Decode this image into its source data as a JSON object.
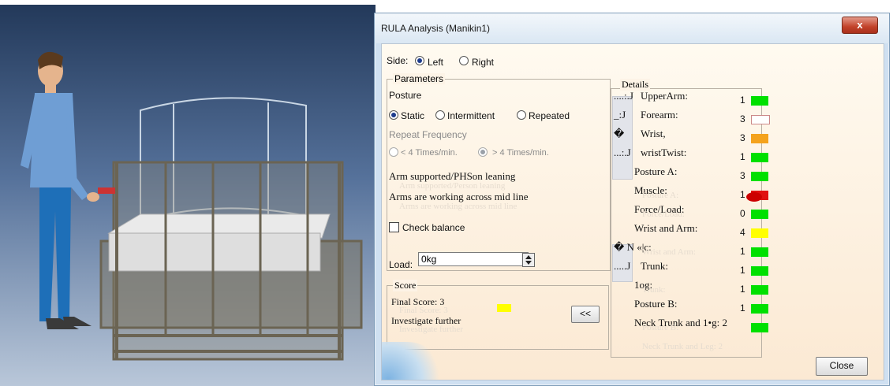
{
  "dialog": {
    "title": "RULA Analysis (Manikin1)",
    "close_glyph": "x",
    "side": {
      "label": "Side:",
      "left": "Left",
      "right": "Right",
      "selected": "Left"
    },
    "parameters": {
      "legend": "Parameters",
      "posture_label": "Posture",
      "posture_options": [
        "Static",
        "Intermittent",
        "Repeated"
      ],
      "posture_selected": "Static",
      "repeat_label": "Repeat Frequency",
      "repeat_options": [
        "< 4 Times/min.",
        "> 4 Times/min."
      ],
      "arm_supported": "Arm supported/PHSon leaning",
      "arm_supported_ghost": "Arm supported/Person leaning",
      "arms_midline": "Arms are working across mid line",
      "arms_midline_ghost": "Arms are working across mid line",
      "check_balance": "Check balance",
      "load_label": "Load:",
      "load_value": "0kg"
    },
    "score": {
      "legend": "Score",
      "final_score": "Final Score: 3",
      "final_score_ghost": "Final Score: 3",
      "recommendation": "Investigate further",
      "recommendation_ghost": "Investigate further",
      "collapse_button": "<<",
      "indicator_color": "#ffff00"
    },
    "details": {
      "legend": "Details",
      "rows": [
        {
          "prefix": "....:.J",
          "label": "UpperArm:",
          "score": "1",
          "color": "#00e000"
        },
        {
          "prefix": "_:J",
          "label": "Forearm:",
          "score": "3",
          "color": "#ffffff"
        },
        {
          "prefix": "�",
          "label": "Wrist,",
          "score": "3",
          "color": "#f4a21c"
        },
        {
          "prefix": "...:.J",
          "label": "wristTwist:",
          "score": "1",
          "color": "#00e000"
        },
        {
          "prefix": "",
          "label": "Posture A:",
          "score": "3",
          "color": "#00e000"
        },
        {
          "prefix": "",
          "label": "Muscle:",
          "score": "1",
          "color": "#e01010"
        },
        {
          "prefix": "",
          "label": "Force/Load:",
          "score": "0",
          "color": "#00e000"
        },
        {
          "prefix": "",
          "label": "Wrist and Arm:",
          "score": "4",
          "color": "#ffff00"
        },
        {
          "prefix": "� N «|c:",
          "label": "",
          "score": "1",
          "color": "#00e000"
        },
        {
          "prefix": ".....J",
          "label": "Trunk:",
          "score": "1",
          "color": "#00e000"
        },
        {
          "prefix": "",
          "label": "1og:",
          "score": "1",
          "color": "#00e000"
        },
        {
          "prefix": "",
          "label": "Posture B:",
          "score": "1",
          "color": "#00e000"
        },
        {
          "prefix": "",
          "label": "Neck Trunk and 1•g: 2",
          "score": "",
          "color": "#00e000"
        }
      ],
      "ghosts": [
        "Posture A:",
        "Force/Load:",
        "Wrist and Arm:",
        "Trunk:",
        "Posture B:",
        "Neck Trunk and Leg: 2"
      ]
    },
    "close_button": "Close"
  }
}
